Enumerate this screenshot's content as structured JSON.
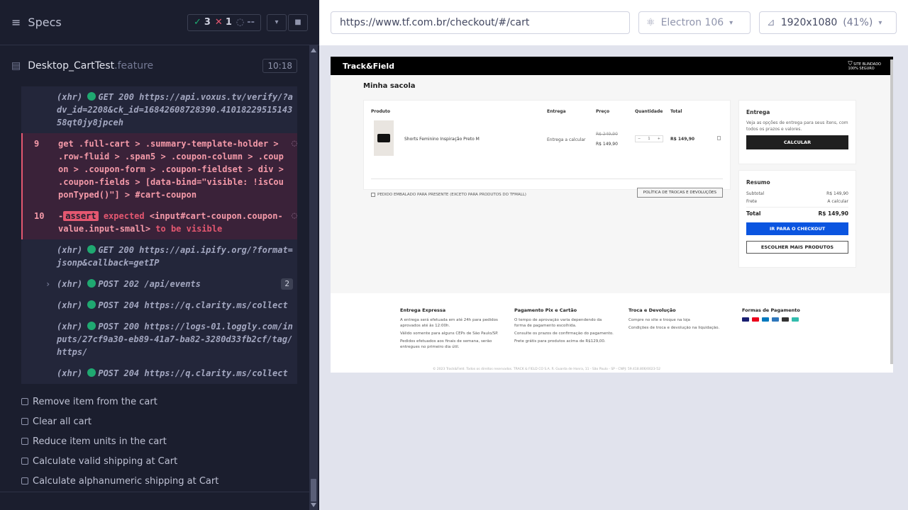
{
  "runner": {
    "specs_title": "Specs",
    "passed": "3",
    "failed": "1",
    "pending": "--",
    "file_name": "Desktop_CartTest",
    "file_ext": ".feature",
    "duration": "10:18"
  },
  "log": [
    {
      "kind": "xhr",
      "num": "",
      "prefix": "(xhr)",
      "method": "GET 200",
      "text": "https://api.voxus.tv/verify/?adv_id=2208&ck_id=16842608728390.4101822951514358qt0jy8jpceh"
    },
    {
      "kind": "fail",
      "num": "9",
      "text": "get .full-cart > .summary-template-holder > .row-fluid > .span5 > .coupon-column > .coupon > .coupon-form > .coupon-fieldset > div > .coupon-fields > [data-bind=\"visible: !isCouponTyped()\"] > #cart-coupon"
    },
    {
      "kind": "assert",
      "num": "10",
      "badge": "assert",
      "text1": "expected",
      "text2": "<input#cart-coupon.coupon-value.input-small>",
      "text3": "to be visible"
    },
    {
      "kind": "xhr",
      "num": "",
      "prefix": "(xhr)",
      "method": "GET 200",
      "text": "https://api.ipify.org/?format=jsonp&callback=getIP"
    },
    {
      "kind": "xhr",
      "num": "",
      "prefix": "(xhr)",
      "method": "POST 202",
      "text": "/api/events",
      "count": "2"
    },
    {
      "kind": "xhr",
      "num": "",
      "prefix": "(xhr)",
      "method": "POST 204",
      "text": "https://q.clarity.ms/collect"
    },
    {
      "kind": "xhr",
      "num": "",
      "prefix": "(xhr)",
      "method": "POST 200",
      "text": "https://logs-01.loggly.com/inputs/27cf9a30-eb89-41a7-ba82-3280d33fb2cf/tag/https/"
    },
    {
      "kind": "xhr",
      "num": "",
      "prefix": "(xhr)",
      "method": "POST 204",
      "text": "https://q.clarity.ms/collect"
    }
  ],
  "tests": [
    "Remove item from the cart",
    "Clear all cart",
    "Reduce item units in the cart",
    "Calculate valid shipping at Cart",
    "Calculate alphanumeric shipping at Cart"
  ],
  "aut": {
    "url": "https://www.tf.com.br/checkout/#/cart",
    "browser": "Electron 106",
    "viewport": "1920x1080",
    "zoom": "(41%)"
  },
  "site": {
    "logo": "Track&Field",
    "secure_line1": "SITE BLINDADO",
    "secure_line2": "100% SEGURO",
    "bag_title": "Minha sacola",
    "col_product": "Produto",
    "col_delivery": "Entrega",
    "col_price": "Preço",
    "col_qty": "Quantidade",
    "col_total": "Total",
    "product_name": "Shorts Feminino Inspiração Preto M",
    "delivery_text": "Entrega a calcular",
    "old_price": "R$ 249,90",
    "price": "R$ 149,90",
    "qty": "1",
    "line_total": "R$ 149,90",
    "gift_text": "PEDIDO EMBALADO PARA PRESENTE (EXCETO PARA PRODUTOS DO TFMALL)",
    "policy_btn": "POLÍTICA DE TROCAS E DEVOLUÇÕES",
    "ship_title": "Entrega",
    "ship_desc": "Veja as opções de entrega para seus itens, com todos os prazos e valores.",
    "calc_btn": "CALCULAR",
    "summary_title": "Resumo",
    "subtotal_label": "Subtotal",
    "subtotal_value": "R$ 149,90",
    "frete_label": "Frete",
    "frete_value": "A calcular",
    "total_label": "Total",
    "total_value": "R$ 149,90",
    "checkout_btn": "IR PARA O CHECKOUT",
    "more_btn": "ESCOLHER MAIS PRODUTOS",
    "f1_title": "Entrega Expressa",
    "f1_p1": "A entrega será efetuada em até 24h para pedidos aprovados até às 12:00h.",
    "f1_p2": "Válido somente para alguns CEPs de São Paulo/SP.",
    "f1_p3": "Pedidos efetuados aos finais de semana, serão entregues no primeiro dia útil.",
    "f2_title": "Pagamento Pix e Cartão",
    "f2_p1": "O tempo de aprovação varia dependendo da forma de pagamento escolhida.",
    "f2_p2": "Consulte os prazos de confirmação do pagamento.",
    "f2_p3": "Frete grátis para produtos acima de R$129,00.",
    "f3_title": "Troca e Devolução",
    "f3_p1": "Compre no site e troque na loja",
    "f3_p2": "Condições de troca e devolução na liquidação.",
    "f4_title": "Formas de Pagamento",
    "copyright": "© 2023 Track&Field. Todos os direitos reservados. TRACK & FIELD CO S.A. R. Guarda de Honra, 11 - São Paulo - SP - CNPJ: 59.418.806/0023-52"
  }
}
